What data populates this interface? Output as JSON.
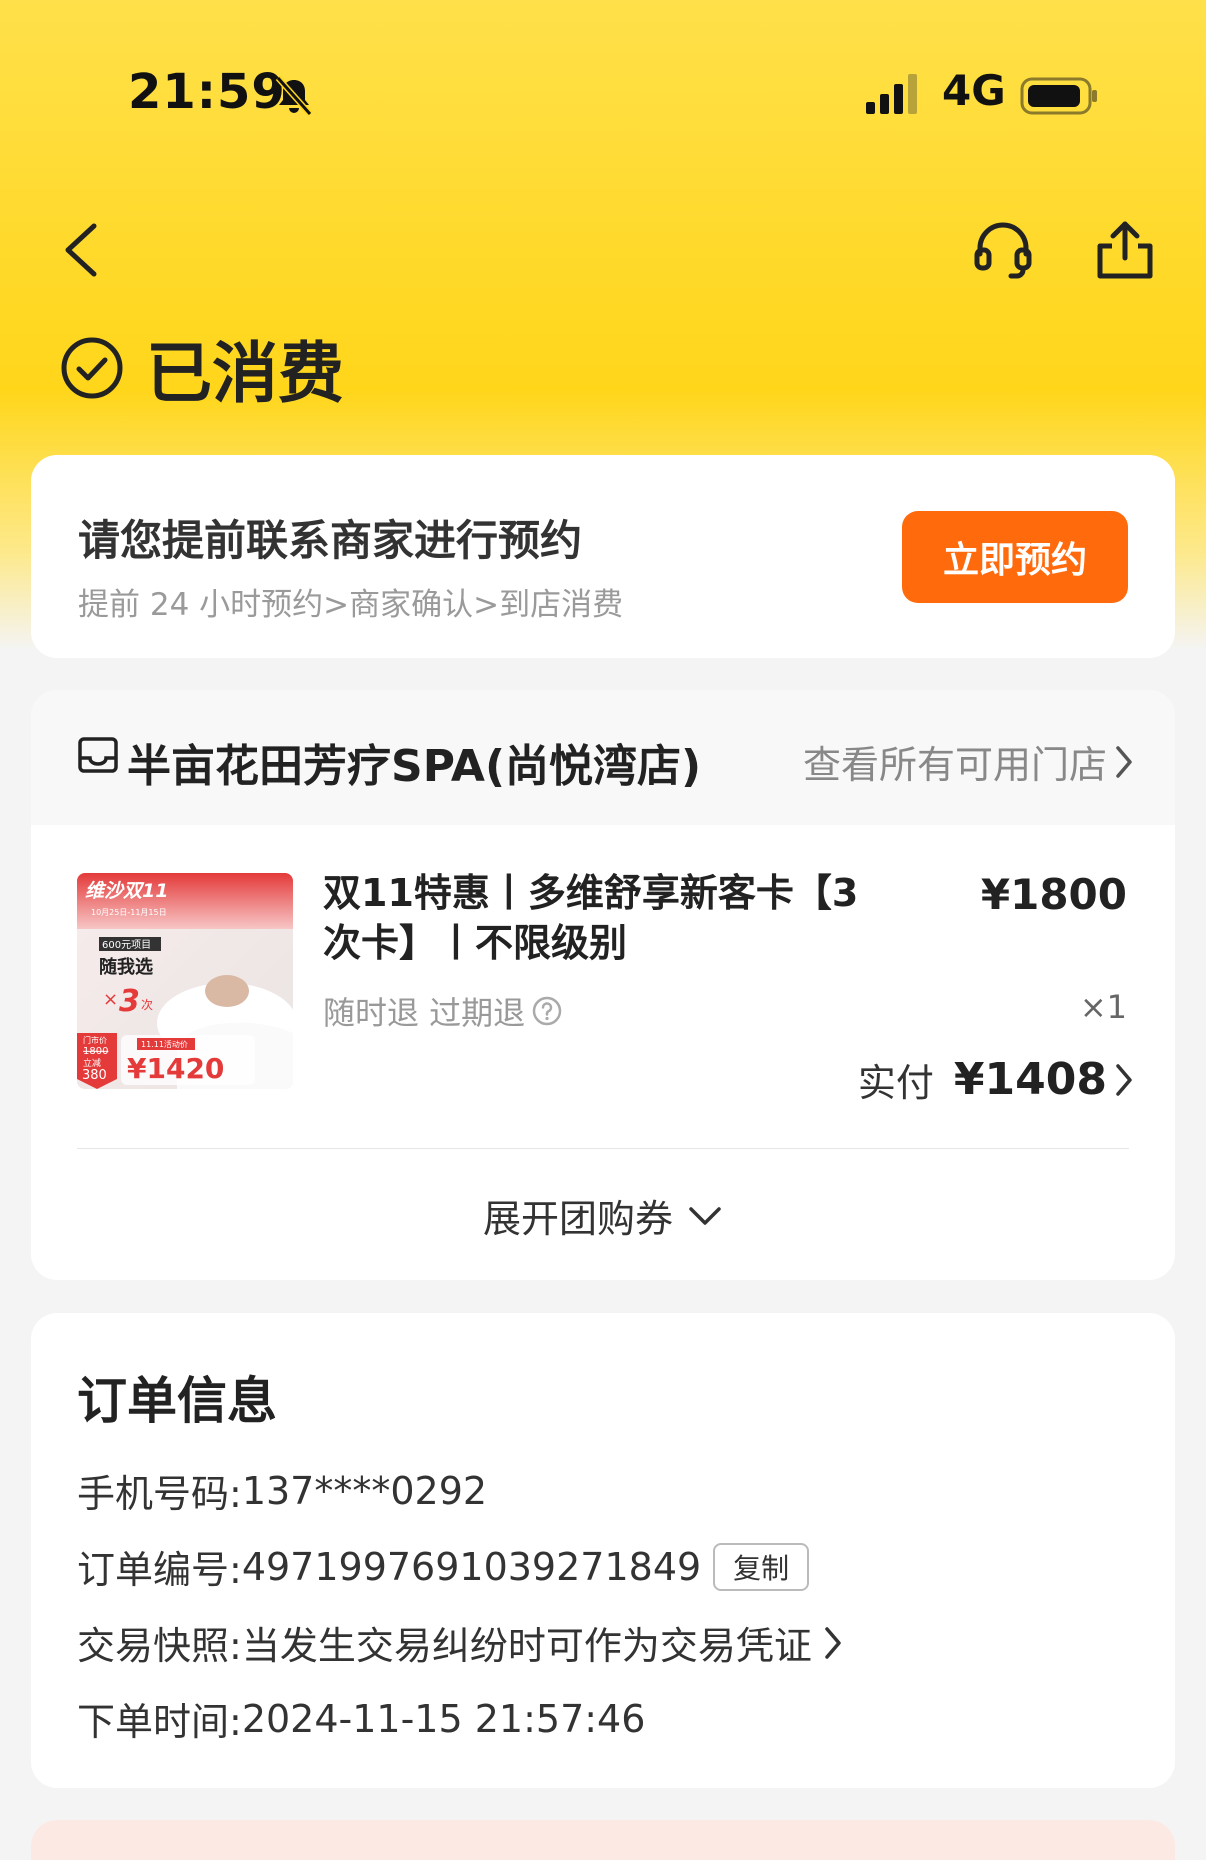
{
  "status_bar": {
    "time": "21:59",
    "network": "4G"
  },
  "order_status": {
    "title": "已消费"
  },
  "appointment": {
    "title": "请您提前联系商家进行预约",
    "subtitle": "提前 24 小时预约>商家确认>到店消费",
    "button": "立即预约"
  },
  "store": {
    "name": "半亩花田芳疗SPA(尚悦湾店)",
    "all_stores_link": "查看所有可用门店"
  },
  "deal": {
    "title": "双11特惠丨多维舒享新客卡【3次卡】丨不限级别",
    "price": "¥1800",
    "refund_policy": "随时退 过期退",
    "quantity": "×1",
    "paid_label": "实付",
    "paid_amount": "¥1408",
    "expand_label": "展开团购券"
  },
  "deal_image": {
    "banner": "维沙双11",
    "dates": "10月25日-11月15日",
    "badge": "600元项目",
    "pick": "随我选",
    "times_prefix": "×",
    "times_num": "3",
    "times_suffix": "次",
    "store_price_label": "门市价",
    "store_price": "1800",
    "discount_label": "立减",
    "discount": "380",
    "promo_tag": "11.11活动价",
    "promo_price": "¥1420"
  },
  "order_info": {
    "title": "订单信息",
    "phone_label": "手机号码:",
    "phone": "137****0292",
    "order_no_label": "订单编号:",
    "order_no": "4971997691039271849",
    "copy": "复制",
    "snapshot_label": "交易快照:",
    "snapshot": "当发生交易纠纷时可作为交易凭证",
    "time_label": "下单时间:",
    "time": "2024-11-15 21:57:46"
  },
  "colors": {
    "header_yellow": "#ffd61a",
    "accent_orange": "#ff6a0d"
  }
}
